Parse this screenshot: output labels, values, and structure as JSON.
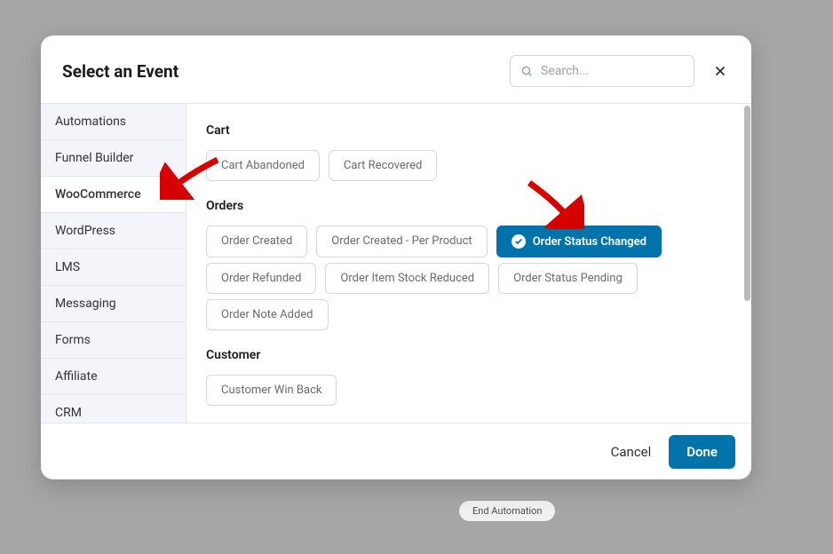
{
  "header": {
    "title": "Select an Event",
    "search_placeholder": "Search..."
  },
  "sidebar": {
    "items": [
      {
        "label": "Automations",
        "active": false
      },
      {
        "label": "Funnel Builder",
        "active": false
      },
      {
        "label": "WooCommerce",
        "active": true
      },
      {
        "label": "WordPress",
        "active": false
      },
      {
        "label": "LMS",
        "active": false
      },
      {
        "label": "Messaging",
        "active": false
      },
      {
        "label": "Forms",
        "active": false
      },
      {
        "label": "Affiliate",
        "active": false
      },
      {
        "label": "CRM",
        "active": false
      }
    ]
  },
  "content": {
    "sections": [
      {
        "title": "Cart",
        "events": [
          {
            "label": "Cart Abandoned",
            "selected": false
          },
          {
            "label": "Cart Recovered",
            "selected": false
          }
        ]
      },
      {
        "title": "Orders",
        "events": [
          {
            "label": "Order Created",
            "selected": false
          },
          {
            "label": "Order Created - Per Product",
            "selected": false
          },
          {
            "label": "Order Status Changed",
            "selected": true
          },
          {
            "label": "Order Refunded",
            "selected": false
          },
          {
            "label": "Order Item Stock Reduced",
            "selected": false
          },
          {
            "label": "Order Status Pending",
            "selected": false
          },
          {
            "label": "Order Note Added",
            "selected": false
          }
        ]
      },
      {
        "title": "Customer",
        "events": [
          {
            "label": "Customer Win Back",
            "selected": false
          }
        ]
      }
    ]
  },
  "footer": {
    "cancel": "Cancel",
    "done": "Done"
  },
  "background": {
    "end_automation": "End Automation"
  },
  "colors": {
    "primary": "#0073aa",
    "annotation": "#d70000"
  }
}
